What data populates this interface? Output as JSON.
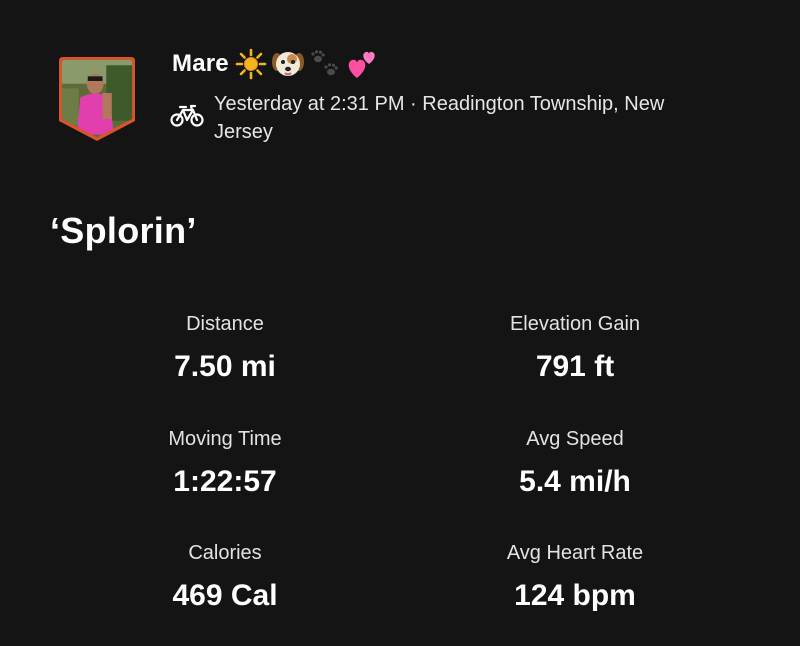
{
  "athlete": {
    "name": "Mare",
    "emoji_icons": [
      "sun-icon",
      "dog-face-icon",
      "paw-prints-icon",
      "two-hearts-icon"
    ]
  },
  "activity": {
    "sport_icon": "bike-icon",
    "meta": "Yesterday at 2:31 PM · Readington Township, New Jersey",
    "title": "‘Splorin’"
  },
  "stats": {
    "distance": {
      "label": "Distance",
      "value": "7.50 mi"
    },
    "elevation_gain": {
      "label": "Elevation Gain",
      "value": "791 ft"
    },
    "moving_time": {
      "label": "Moving Time",
      "value": "1:22:57"
    },
    "avg_speed": {
      "label": "Avg Speed",
      "value": "5.4 mi/h"
    },
    "calories": {
      "label": "Calories",
      "value": "469 Cal"
    },
    "avg_heart_rate": {
      "label": "Avg Heart Rate",
      "value": "124 bpm"
    }
  },
  "colors": {
    "background": "#151414",
    "text_primary": "#ffffff",
    "avatar_border": "#d9532b",
    "heart_pink": "#ff4fa3"
  }
}
